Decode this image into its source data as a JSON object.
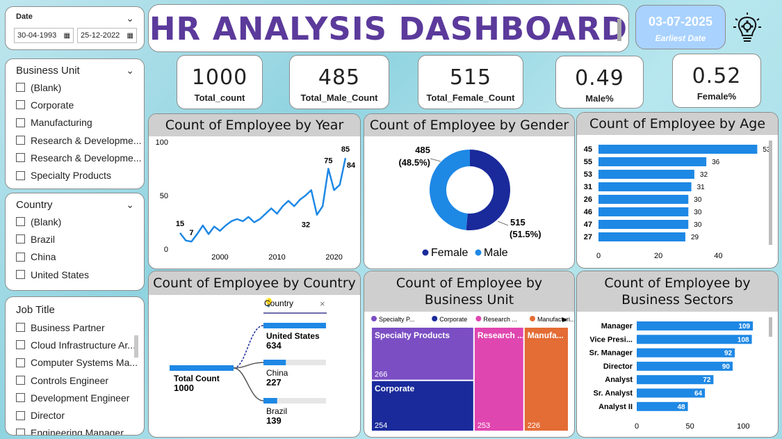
{
  "date_slicer": {
    "label": "Date",
    "start": "30-04-1993",
    "end": "25-12-2022"
  },
  "title": "HR ANALYSIS DASHBOARD",
  "date_card": {
    "value": "03-07-2025",
    "caption": "Earliest Date"
  },
  "business_unit_slicer": {
    "label": "Business Unit",
    "items": [
      "(Blank)",
      "Corporate",
      "Manufacturing",
      "Research & Developme...",
      "Research & Developme...",
      "Specialty Products"
    ]
  },
  "country_slicer": {
    "label": "Country",
    "items": [
      "(Blank)",
      "Brazil",
      "China",
      "United States"
    ]
  },
  "job_title_slicer": {
    "label": "Job Title",
    "items": [
      "Business Partner",
      "Cloud Infrastructure Ar...",
      "Computer Systems Ma...",
      "Controls Engineer",
      "Development Engineer",
      "Director",
      "Engineering Manager"
    ]
  },
  "kpis": [
    {
      "value": "1000",
      "label": "Total_count"
    },
    {
      "value": "485",
      "label": "Total_Male_Count"
    },
    {
      "value": "515",
      "label": "Total_Female_Count"
    },
    {
      "value": "0.49",
      "label": "Male%"
    },
    {
      "value": "0.52",
      "label": "Female%"
    }
  ],
  "panels": {
    "year": "Count of Employee by Year",
    "gender": "Count of Employee by Gender",
    "age": "Count of Employee by Age",
    "country": "Count of Employee by Country",
    "business_unit": "Count of Employee by Business Unit",
    "sectors": "Count of Employee by Business Sectors"
  },
  "colors": {
    "accent": "#1e88e5",
    "female": "#1a2a9b",
    "male": "#1e88e5",
    "purple": "#6a3aa3",
    "card_blue": "#a9d2ff",
    "date_text": "#ffffff"
  },
  "chart_data": [
    {
      "type": "line",
      "title": "Count of Employee by Year",
      "x": [
        1993,
        1994,
        1995,
        1996,
        1997,
        1998,
        1999,
        2000,
        2001,
        2002,
        2003,
        2004,
        2005,
        2006,
        2007,
        2008,
        2009,
        2010,
        2011,
        2012,
        2013,
        2014,
        2015,
        2016,
        2017,
        2018,
        2019,
        2020,
        2021,
        2022
      ],
      "values": [
        15,
        8,
        7,
        14,
        22,
        14,
        21,
        17,
        22,
        26,
        28,
        26,
        30,
        25,
        28,
        33,
        38,
        33,
        40,
        45,
        40,
        46,
        50,
        55,
        32,
        40,
        75,
        55,
        60,
        85
      ],
      "point_labels": [
        {
          "x": 1993,
          "text": "15"
        },
        {
          "x": 1995,
          "text": "7"
        },
        {
          "x": 2017,
          "text": "32"
        },
        {
          "x": 2019,
          "text": "75"
        },
        {
          "x": 2022,
          "text": "85"
        },
        {
          "x": 2022,
          "text": "84"
        }
      ],
      "x_ticks": [
        "2000",
        "2010",
        "2020"
      ],
      "y_ticks": [
        "0",
        "50",
        "100"
      ],
      "ylim": [
        0,
        100
      ]
    },
    {
      "type": "pie",
      "title": "Count of Employee by Gender",
      "slices": [
        {
          "name": "Female",
          "value": 515,
          "label": "515",
          "pct": "(51.5%)",
          "color": "#1a2a9b"
        },
        {
          "name": "Male",
          "value": 485,
          "label": "485",
          "pct": "(48.5%)",
          "color": "#1e88e5"
        }
      ],
      "legend": [
        "Female",
        "Male"
      ]
    },
    {
      "type": "bar",
      "title": "Count of Employee by Age",
      "categories": [
        "45",
        "55",
        "53",
        "31",
        "26",
        "46",
        "47",
        "27"
      ],
      "values": [
        53,
        36,
        32,
        31,
        30,
        30,
        30,
        29
      ],
      "x_ticks": [
        "0",
        "20",
        "40"
      ],
      "xlim": [
        0,
        55
      ]
    },
    {
      "type": "bar",
      "title": "Count of Employee by Country",
      "root": {
        "label": "Total Count",
        "value": "1000"
      },
      "filter_label": "Country",
      "categories": [
        "United States",
        "China",
        "Brazil"
      ],
      "values": [
        634,
        227,
        139
      ]
    },
    {
      "type": "heatmap",
      "title": "Count of Employee by Business Unit",
      "legend": [
        "Specialty P...",
        "Corporate",
        "Research ...",
        "Manufacturi..."
      ],
      "tiles": [
        {
          "name": "Specialty Products",
          "value": 266,
          "color": "#7b4ec4"
        },
        {
          "name": "Corporate",
          "value": 254,
          "color": "#1a2a9b"
        },
        {
          "name": "Research ...",
          "value": 253,
          "color": "#e046b0"
        },
        {
          "name": "Manufa...",
          "value": 226,
          "color": "#e46c35"
        }
      ]
    },
    {
      "type": "bar",
      "title": "Count of Employee by Business Sectors",
      "categories": [
        "Manager",
        "Vice Presi...",
        "Sr. Manager",
        "Director",
        "Analyst",
        "Sr. Analyst",
        "Analyst II"
      ],
      "values": [
        109,
        108,
        92,
        90,
        72,
        64,
        48
      ],
      "x_ticks": [
        "0",
        "50",
        "100"
      ],
      "xlim": [
        0,
        120
      ]
    }
  ]
}
